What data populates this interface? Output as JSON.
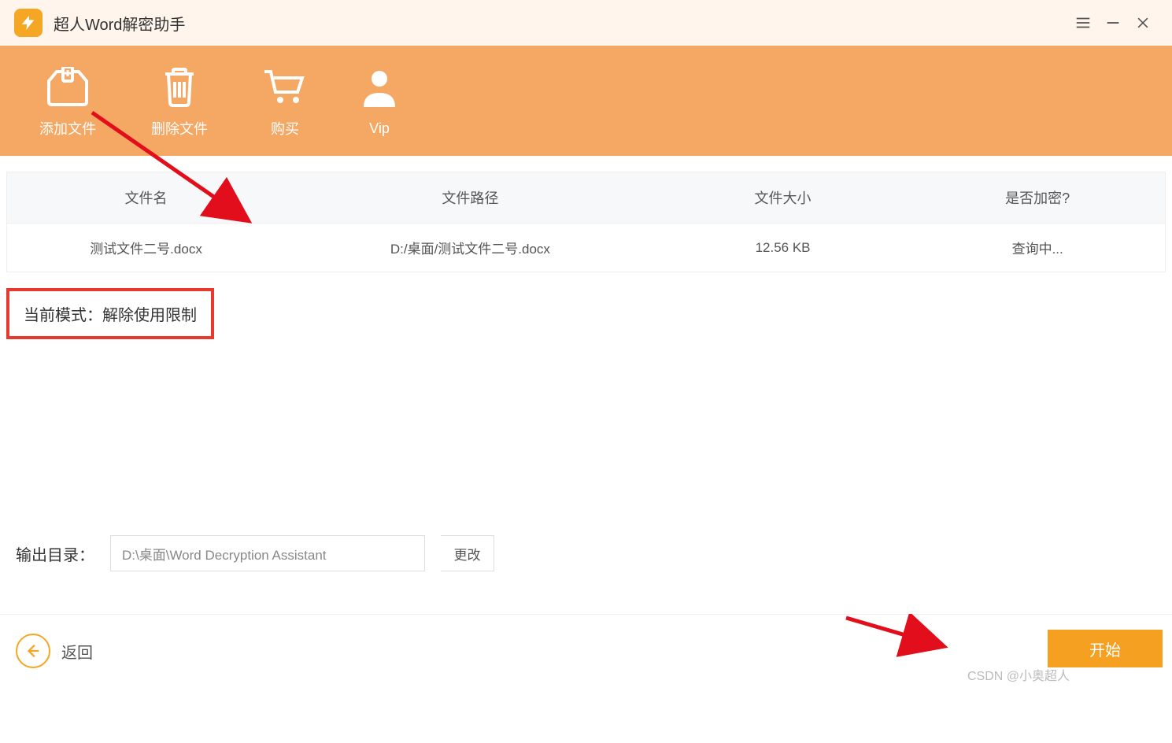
{
  "app": {
    "title": "超人Word解密助手"
  },
  "toolbar": {
    "add": "添加文件",
    "delete": "删除文件",
    "buy": "购买",
    "vip": "Vip"
  },
  "table": {
    "headers": {
      "name": "文件名",
      "path": "文件路径",
      "size": "文件大小",
      "encrypted": "是否加密?"
    },
    "rows": [
      {
        "name": "测试文件二号.docx",
        "path": "D:/桌面/测试文件二号.docx",
        "size": "12.56 KB",
        "encrypted": "查询中..."
      }
    ]
  },
  "mode": {
    "label": "当前模式：解除使用限制"
  },
  "output": {
    "label": "输出目录：",
    "value": "D:\\桌面\\Word Decryption Assistant",
    "change": "更改"
  },
  "footer": {
    "back": "返回",
    "start": "开始"
  },
  "watermark": "CSDN @小奥超人"
}
